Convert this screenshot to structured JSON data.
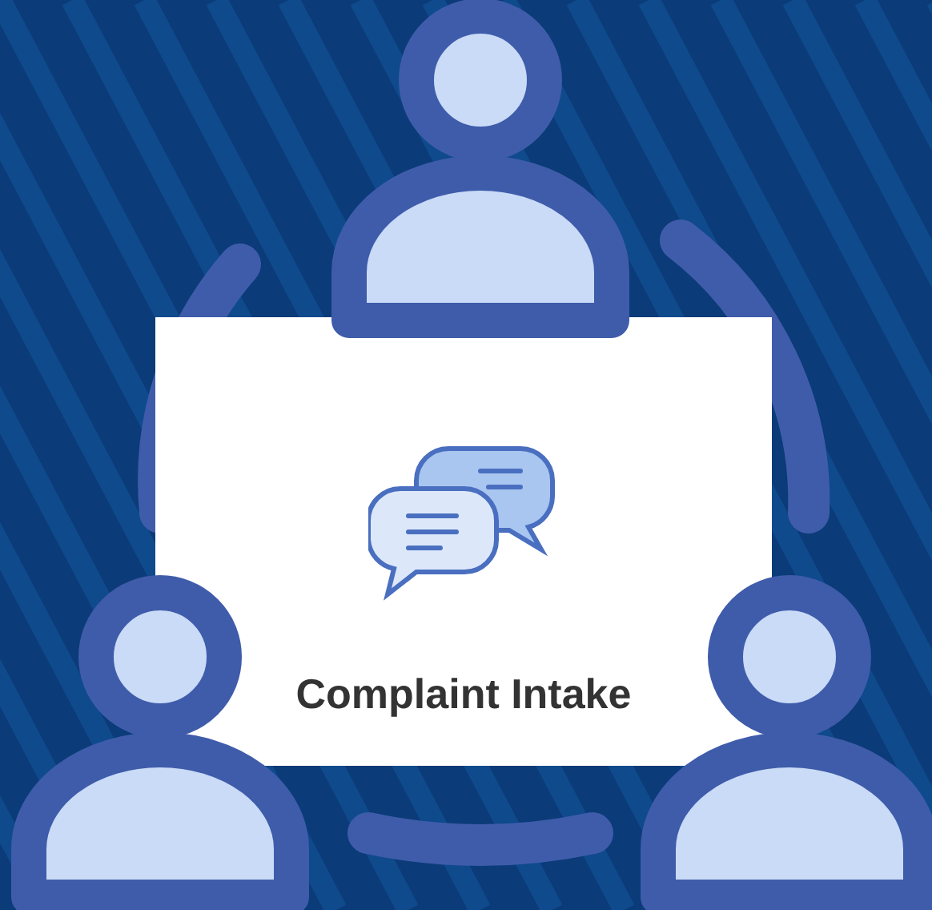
{
  "card": {
    "title": "Complaint Intake"
  }
}
